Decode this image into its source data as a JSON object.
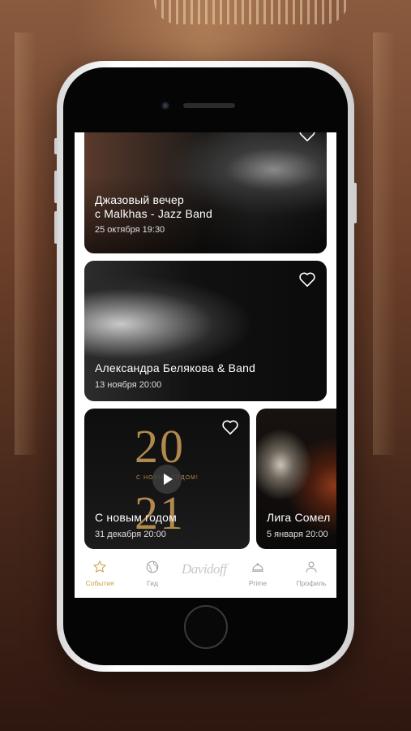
{
  "events": [
    {
      "title_line1": "Джазовый вечер",
      "title_line2": "с Malkhas - Jazz Band",
      "date": "25 октября 19:30"
    },
    {
      "title": "Александра Белякова & Band",
      "date": "13 ноября 20:00"
    },
    {
      "title": "С новым годом",
      "date": "31 декабря 20:00",
      "year_top": "20",
      "year_bottom": "21",
      "year_caption": "С НОВЫМ ГОДОМ!"
    },
    {
      "title": "Лига Сомел",
      "date": "5 января 20:00"
    }
  ],
  "tabbar": {
    "items": [
      {
        "label": "События",
        "icon": "star-icon",
        "active": true
      },
      {
        "label": "Гид",
        "icon": "globe-icon"
      },
      {
        "label": "Prime",
        "icon": "cloche-icon"
      },
      {
        "label": "Профиль",
        "icon": "user-icon"
      }
    ],
    "brand": "Davidoff"
  },
  "colors": {
    "accent": "#c9a34a",
    "inactive": "#9b9b9b",
    "gold_text": "#b0894e"
  }
}
